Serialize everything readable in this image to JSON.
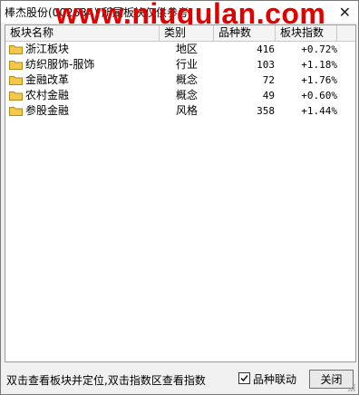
{
  "window": {
    "title": "棒杰股份(002634)  所属板块仅供参考",
    "watermark": "www.niugulan.com",
    "close_glyph": "✕"
  },
  "table": {
    "headers": [
      "板块名称",
      "类别",
      "品种数",
      "板块指数"
    ],
    "rows": [
      {
        "name": "浙江板块",
        "type": "地区",
        "count": "416",
        "index": "+0.72%"
      },
      {
        "name": "纺织服饰-服饰",
        "type": "行业",
        "count": "103",
        "index": "+1.18%"
      },
      {
        "name": "金融改革",
        "type": "概念",
        "count": "72",
        "index": "+1.76%"
      },
      {
        "name": "农村金融",
        "type": "概念",
        "count": "49",
        "index": "+0.60%"
      },
      {
        "name": "参股金融",
        "type": "风格",
        "count": "358",
        "index": "+1.44%"
      }
    ]
  },
  "footer": {
    "hint": "双击查看板块并定位,双击指数区查看指数",
    "checkbox_label": "品种联动",
    "checkbox_checked": true,
    "close_button": "关闭"
  },
  "colors": {
    "watermark": "#e00000",
    "folder": "#f2c94c"
  }
}
